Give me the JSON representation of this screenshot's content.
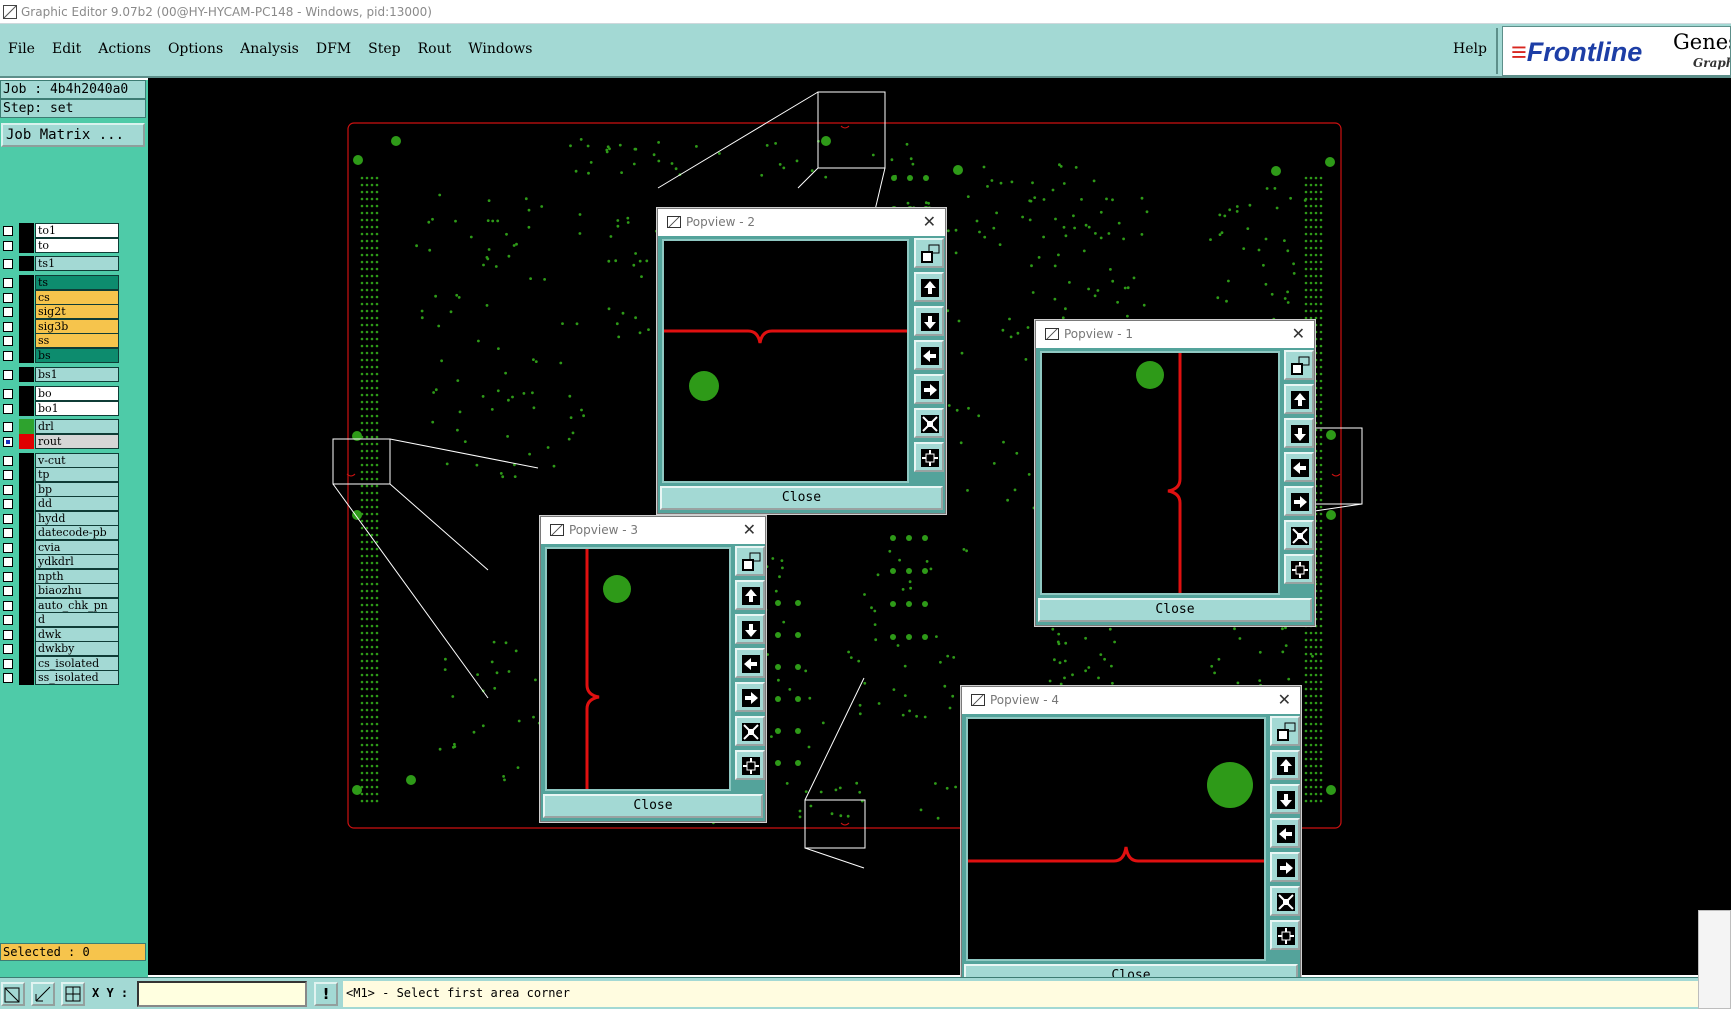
{
  "window": {
    "title": "Graphic Editor 9.07b2 (00@HY-HYCAM-PC148 - Windows, pid:13000)"
  },
  "menu": {
    "items": [
      "File",
      "Edit",
      "Actions",
      "Options",
      "Analysis",
      "DFM",
      "Step",
      "Rout",
      "Windows"
    ],
    "help": "Help"
  },
  "logo": {
    "brand": "Frontline",
    "product": "Genes",
    "subtitle": "Graph"
  },
  "job": {
    "job_line": "Job : 4b4h2040a0",
    "step_line": "Step: set",
    "matrix_button": "Job Matrix ..."
  },
  "layers": [
    {
      "name": "to1",
      "color": "#ffffff"
    },
    {
      "name": "to",
      "color": "#ffffff"
    },
    {
      "name": "ts1",
      "color": "#a3d9d4"
    },
    {
      "name": "ts",
      "color": "#0d8c6e"
    },
    {
      "name": "cs",
      "color": "#f6c44c"
    },
    {
      "name": "sig2t",
      "color": "#f6c44c"
    },
    {
      "name": "sig3b",
      "color": "#f6c44c"
    },
    {
      "name": "ss",
      "color": "#f6c44c"
    },
    {
      "name": "bs",
      "color": "#0d8c6e"
    },
    {
      "name": "bs1",
      "color": "#a3d9d4"
    },
    {
      "name": "bo",
      "color": "#ffffff"
    },
    {
      "name": "bo1",
      "color": "#ffffff"
    },
    {
      "name": "drl",
      "color": "#a3d9d4",
      "swatch": "#2ea32e"
    },
    {
      "name": "rout",
      "color": "#d6d6d6",
      "swatch": "#e00000",
      "checked": true
    },
    {
      "name": "v-cut",
      "color": "#a3d9d4"
    },
    {
      "name": "tp",
      "color": "#a3d9d4"
    },
    {
      "name": "bp",
      "color": "#a3d9d4"
    },
    {
      "name": "dd",
      "color": "#a3d9d4"
    },
    {
      "name": "hydd",
      "color": "#a3d9d4"
    },
    {
      "name": "datecode-pb",
      "color": "#a3d9d4"
    },
    {
      "name": "cvia",
      "color": "#a3d9d4"
    },
    {
      "name": "ydkdrl",
      "color": "#a3d9d4"
    },
    {
      "name": "npth",
      "color": "#a3d9d4"
    },
    {
      "name": "biaozhu",
      "color": "#a3d9d4"
    },
    {
      "name": "auto_chk_pn",
      "color": "#a3d9d4"
    },
    {
      "name": "d",
      "color": "#a3d9d4"
    },
    {
      "name": "dwk",
      "color": "#a3d9d4"
    },
    {
      "name": "dwkby",
      "color": "#a3d9d4"
    },
    {
      "name": "cs_isolated",
      "color": "#a3d9d4"
    },
    {
      "name": "ss_isolated",
      "color": "#a3d9d4"
    }
  ],
  "status": {
    "selected": "Selected : 0",
    "xy_label": "X Y :",
    "xy_value": "",
    "warn": "!",
    "prompt": "<M1> - Select first area corner"
  },
  "popviews": [
    {
      "title": "Popview - 2",
      "close": "Close"
    },
    {
      "title": "Popview - 1",
      "close": "Close"
    },
    {
      "title": "Popview - 3",
      "close": "Close"
    },
    {
      "title": "Popview - 4",
      "close": "Close"
    }
  ],
  "colors": {
    "board_outline": "#cc1111",
    "drill": "#2e9a18",
    "panel_bg": "#a3d9d4",
    "layer_panel": "#4ecba8"
  }
}
